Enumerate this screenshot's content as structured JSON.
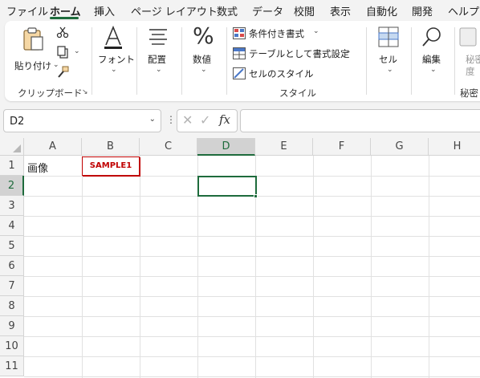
{
  "menu": {
    "items": [
      "ファイル",
      "ホーム",
      "挿入",
      "ページ レイアウト",
      "数式",
      "データ",
      "校閲",
      "表示",
      "自動化",
      "開発",
      "ヘルプ"
    ],
    "active": "ホーム"
  },
  "ribbon": {
    "clipboard": {
      "paste_label": "貼り付け",
      "group_label": "クリップボード"
    },
    "font": {
      "label": "フォント"
    },
    "alignment": {
      "label": "配置"
    },
    "number": {
      "label": "数値"
    },
    "styles": {
      "conditional_formatting": "条件付き書式",
      "format_as_table": "テーブルとして書式設定",
      "cell_styles": "セルのスタイル",
      "group_label": "スタイル"
    },
    "cells": {
      "label": "セル"
    },
    "editing": {
      "label": "編集"
    },
    "sensitivity": {
      "label_line1": "秘密",
      "label_line2": "度",
      "group_label": "秘密"
    }
  },
  "formula_bar": {
    "name_box": "D2",
    "formula": "",
    "fx": "fx"
  },
  "sheet": {
    "columns": [
      "A",
      "B",
      "C",
      "D",
      "E",
      "F",
      "G",
      "H"
    ],
    "rows": [
      "1",
      "2",
      "3",
      "4",
      "5",
      "6",
      "7",
      "8",
      "9",
      "10",
      "11"
    ],
    "selected_column": "D",
    "selected_row": "2",
    "cells": {
      "A1": "画像"
    },
    "image_label": "SAMPLE1"
  },
  "colors": {
    "accent": "#1e6b3c",
    "image_border": "#c00000"
  }
}
